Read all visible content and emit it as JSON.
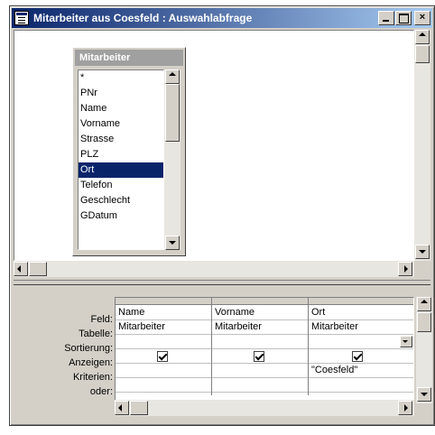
{
  "window": {
    "title": "Mitarbeiter aus Coesfeld : Auswahlabfrage",
    "controls": {
      "minimize": "_",
      "maximize": "□",
      "close": "×"
    }
  },
  "table_list": {
    "title": "Mitarbeiter",
    "fields": [
      "*",
      "PNr",
      "Name",
      "Vorname",
      "Strasse",
      "PLZ",
      "Ort",
      "Telefon",
      "Geschlecht",
      "GDatum"
    ],
    "selected_field": "Ort"
  },
  "grid": {
    "row_labels": {
      "feld": "Feld:",
      "tabelle": "Tabelle:",
      "sortierung": "Sortierung:",
      "anzeigen": "Anzeigen:",
      "kriterien": "Kriterien:",
      "oder": "oder:"
    },
    "columns": [
      {
        "feld": "Name",
        "tabelle": "Mitarbeiter",
        "sortierung": "",
        "anzeigen": true,
        "kriterien": "",
        "oder": ""
      },
      {
        "feld": "Vorname",
        "tabelle": "Mitarbeiter",
        "sortierung": "",
        "anzeigen": true,
        "kriterien": "",
        "oder": ""
      },
      {
        "feld": "Ort",
        "tabelle": "Mitarbeiter",
        "sortierung": "",
        "anzeigen": true,
        "kriterien": "\"Coesfeld\"",
        "oder": ""
      }
    ]
  },
  "icons": {
    "window_icon": "query-icon",
    "scroll_up": "arrow-up-icon",
    "scroll_down": "arrow-down-icon",
    "scroll_left": "arrow-left-icon",
    "scroll_right": "arrow-right-icon"
  },
  "colors": {
    "titlebar_start": "#0a246a",
    "titlebar_end": "#a6caf0",
    "selection": "#0a246a",
    "face": "#d4d0c8"
  }
}
